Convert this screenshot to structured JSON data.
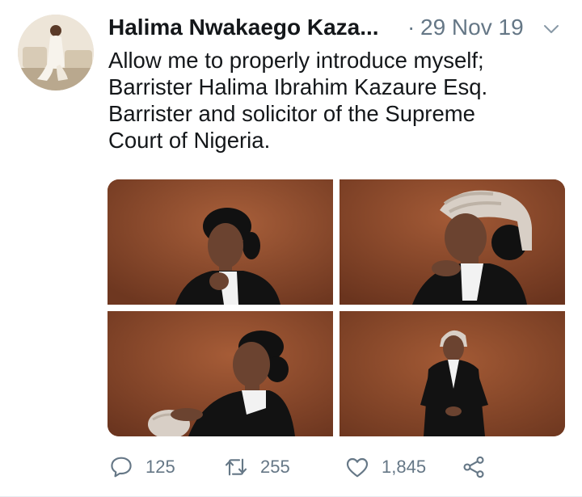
{
  "tweet": {
    "author_name": "Halima Nwakaego Kaza...",
    "separator": "·",
    "date": "29 Nov 19",
    "text_lines": [
      "Allow me to properly introduce myself;",
      "Barrister Halima Ibrahim Kazaure Esq.",
      "Barrister and solicitor of the Supreme",
      "Court of Nigeria."
    ]
  },
  "media": {
    "photos": [
      {
        "subject": "portrait-no-wig"
      },
      {
        "subject": "portrait-with-wig-profile"
      },
      {
        "subject": "portrait-holding-wig"
      },
      {
        "subject": "full-length-with-wig"
      }
    ],
    "backdrop_color": "#8b4a2b"
  },
  "actions": {
    "reply_count": "125",
    "retweet_count": "255",
    "like_count": "1,845"
  },
  "icons": {
    "reply": "reply-icon",
    "retweet": "retweet-icon",
    "like": "heart-icon",
    "share": "share-icon",
    "more": "chevron-down-icon"
  },
  "colors": {
    "text": "#14171a",
    "secondary": "#657786"
  }
}
